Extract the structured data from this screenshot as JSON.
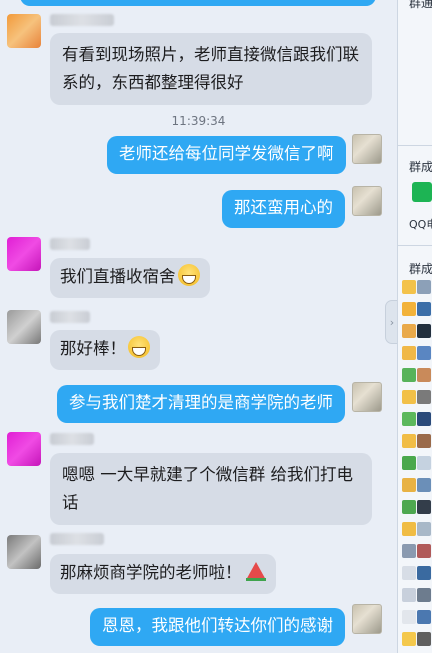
{
  "timestamp": "11:39:34",
  "messages": [
    {
      "side": "in",
      "text": "有看到现场照片，老师直接微信跟我们联系的，东西都整理得很好"
    },
    {
      "side": "out",
      "text": "老师还给每位同学发微信了啊"
    },
    {
      "side": "out",
      "text": "那还蛮用心的"
    },
    {
      "side": "in",
      "text": "我们直播收宿舍",
      "emoji": "grin-icon"
    },
    {
      "side": "in",
      "text": "那好棒！",
      "emoji": "grin-icon"
    },
    {
      "side": "out",
      "text": "参与我们楚才清理的是商学院的老师"
    },
    {
      "side": "in",
      "text": "嗯嗯 一大早就建了个微信群 给我们打电话"
    },
    {
      "side": "in",
      "text": "那麻烦商学院的老师啦！",
      "emoji": "watermelon-icon"
    },
    {
      "side": "out",
      "text": "恩恩，我跟他们转达你们的感谢"
    }
  ],
  "side_panel": {
    "label_top": "群通",
    "label_group1": "群成",
    "app_label": "QQ电",
    "label_group2": "群成"
  },
  "colors": {
    "bubble_out": "#2fa8f3",
    "bubble_in": "#d6dce6",
    "background": "#e9eef6"
  }
}
